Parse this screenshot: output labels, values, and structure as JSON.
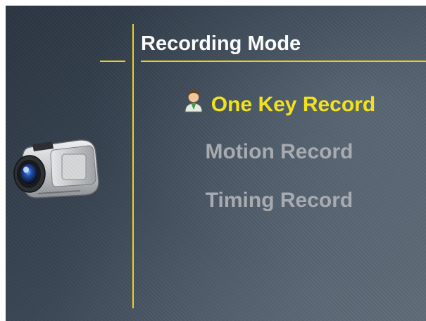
{
  "screen": {
    "title": "Recording Mode"
  },
  "menu": {
    "selected_index": 0,
    "items": [
      {
        "label": "One Key Record",
        "selected": true,
        "icon": "user-icon"
      },
      {
        "label": "Motion Record",
        "selected": false
      },
      {
        "label": "Timing Record",
        "selected": false
      }
    ]
  },
  "icons": {
    "side_illustration": "camcorder-icon"
  },
  "colors": {
    "accent": "#f2d21a",
    "selected_text": "#f6e51a",
    "unselected_text": "#a9adb2",
    "title_text": "#ffffff",
    "background": "#3a4654"
  }
}
